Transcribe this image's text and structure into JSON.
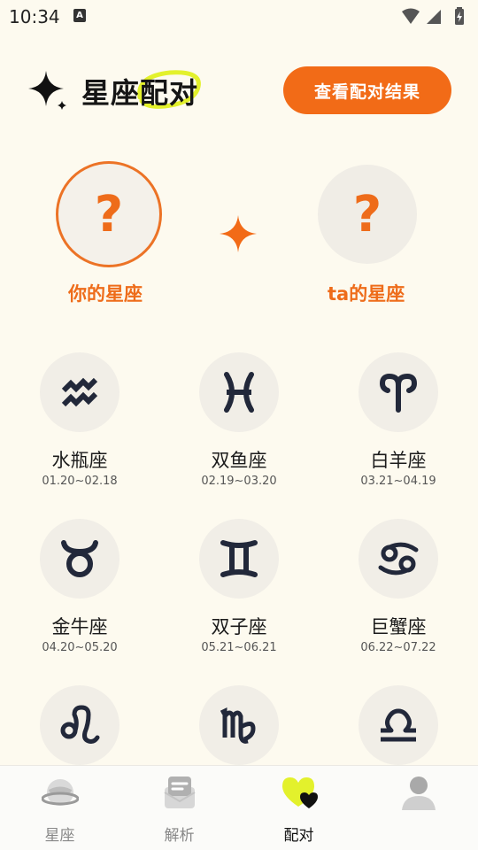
{
  "status_bar": {
    "time": "10:34",
    "app_badge": "A"
  },
  "header": {
    "title": "星座配对",
    "result_button": "查看配对结果"
  },
  "pair": {
    "you_symbol": "?",
    "you_label": "你的星座",
    "ta_symbol": "?",
    "ta_label": "ta的星座"
  },
  "signs": [
    {
      "name": "水瓶座",
      "dates": "01.20~02.18",
      "icon": "aquarius-icon"
    },
    {
      "name": "双鱼座",
      "dates": "02.19~03.20",
      "icon": "pisces-icon"
    },
    {
      "name": "白羊座",
      "dates": "03.21~04.19",
      "icon": "aries-icon"
    },
    {
      "name": "金牛座",
      "dates": "04.20~05.20",
      "icon": "taurus-icon"
    },
    {
      "name": "双子座",
      "dates": "05.21~06.21",
      "icon": "gemini-icon"
    },
    {
      "name": "巨蟹座",
      "dates": "06.22~07.22",
      "icon": "cancer-icon"
    },
    {
      "name": "",
      "dates": "",
      "icon": "leo-icon"
    },
    {
      "name": "",
      "dates": "",
      "icon": "virgo-icon"
    },
    {
      "name": "",
      "dates": "",
      "icon": "libra-icon"
    }
  ],
  "bottom_nav": [
    {
      "label": "星座",
      "icon": "planet-icon"
    },
    {
      "label": "解析",
      "icon": "message-icon"
    },
    {
      "label": "配对",
      "icon": "heart-match-icon",
      "active": true
    },
    {
      "label": "",
      "icon": "profile-icon"
    }
  ],
  "colors": {
    "accent": "#f26b17",
    "background": "#fdfaef",
    "highlight": "#e3f12c",
    "icon_dark": "#22283a"
  }
}
